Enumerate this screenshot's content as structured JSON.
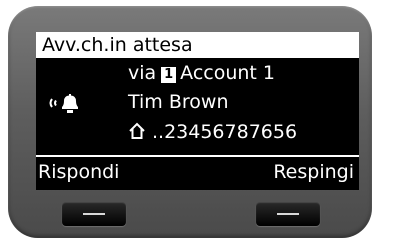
{
  "header": {
    "title": "Avv.ch.in attesa"
  },
  "call": {
    "via_label": "via",
    "account_number": "1",
    "account_name": "Account 1",
    "caller_name": "Tim Brown",
    "caller_number": "..23456787656",
    "status_icon": "ringing-bell-icon",
    "number_type_icon": "home-icon"
  },
  "softkeys": {
    "left_label": "Rispondi",
    "right_label": "Respingi"
  },
  "colors": {
    "screen_bg": "#000000",
    "header_bg": "#ffffff",
    "text": "#ffffff",
    "bezel": "#5e5e5e"
  }
}
